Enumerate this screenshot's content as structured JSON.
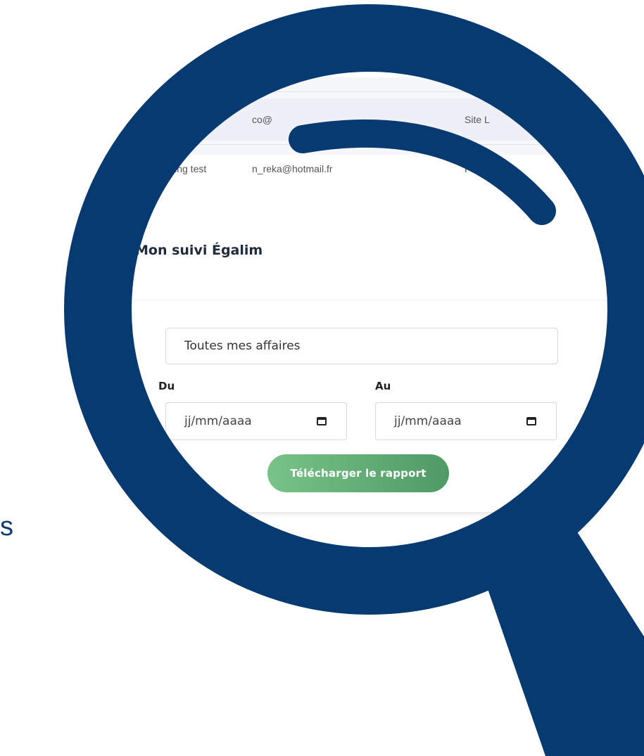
{
  "brand": {
    "lens_color": "#063a70",
    "accent_green": "#1fbf5a",
    "button_gradient": [
      "#78c387",
      "#4f9a66"
    ]
  },
  "background_text": {
    "stray_letter": "s"
  },
  "table": {
    "rows": [
      {
        "col1": "",
        "col2": "co@",
        "col3": "Site L"
      },
      {
        "col1": "ling test",
        "col2": "n_reka@hotmail.fr",
        "col3": "Pl"
      }
    ]
  },
  "section": {
    "title": "Mon suivi Égalim"
  },
  "form": {
    "scope_select_value": "Toutes mes affaires",
    "from_label": "Du",
    "to_label": "Au",
    "from_placeholder": "jj/mm/aaaa",
    "to_placeholder": "jj/mm/aaaa",
    "from_icon": "calendar-icon",
    "to_icon": "calendar-icon",
    "download_button_label": "Télécharger le rapport"
  }
}
